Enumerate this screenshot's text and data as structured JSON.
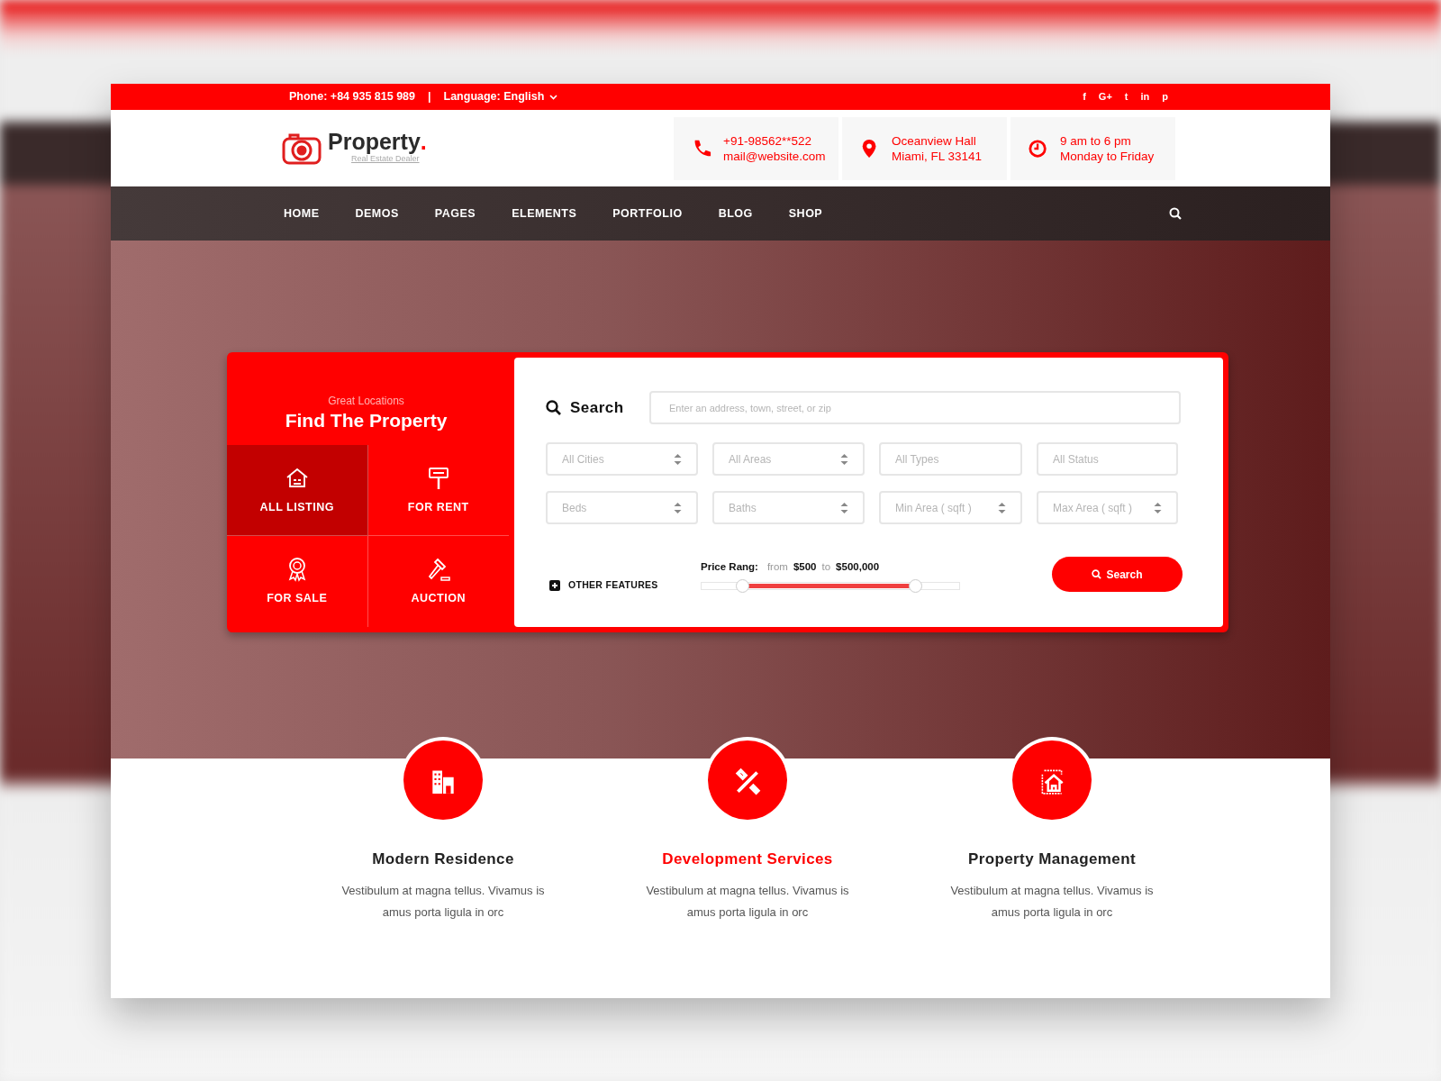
{
  "topbar": {
    "phone": "Phone:  +84 935 815 989",
    "separator": "|",
    "language": "Language:  English",
    "socials": [
      "f",
      "G+",
      "t",
      "in",
      "p"
    ]
  },
  "header": {
    "logo": {
      "name": "Property",
      "dot": ".",
      "tagline": "Real Estate Dealer"
    },
    "contacts": [
      {
        "kind": "phone",
        "lines": [
          "+91-98562**522",
          "mail@website.com"
        ]
      },
      {
        "kind": "pin",
        "lines": [
          "Oceanview Hall",
          "Miami, FL 33141"
        ]
      },
      {
        "kind": "clock",
        "lines": [
          "9 am to 6 pm",
          "Monday to Friday"
        ]
      }
    ]
  },
  "nav": {
    "items": [
      "HOME",
      "DEMOS",
      "PAGES",
      "ELEMENTS",
      "PORTFOLIO",
      "BLOG",
      "SHOP"
    ]
  },
  "finder": {
    "subtitle": "Great Locations",
    "title": "Find The Property",
    "tabs": [
      {
        "label": "ALL LISTING",
        "kind": "house",
        "selected": true
      },
      {
        "label": "FOR RENT",
        "kind": "rent",
        "selected": false
      },
      {
        "label": "FOR SALE",
        "kind": "award",
        "selected": false
      },
      {
        "label": "AUCTION",
        "kind": "gavel",
        "selected": false
      }
    ],
    "search_label": "Search",
    "search_placeholder": "Enter an address, town, street, or zip",
    "filters": [
      {
        "label": "All Cities",
        "kind": "select"
      },
      {
        "label": "All Areas",
        "kind": "select"
      },
      {
        "label": "All Types",
        "kind": "text"
      },
      {
        "label": "All Status",
        "kind": "text"
      },
      {
        "label": "Beds",
        "kind": "select"
      },
      {
        "label": "Baths",
        "kind": "select"
      },
      {
        "label": "Min Area ( sqft )",
        "kind": "select"
      },
      {
        "label": "Max Area ( sqft )",
        "kind": "select"
      }
    ],
    "other_features": "OTHER FEATURES",
    "price": {
      "label": "Price Rang:",
      "from": "from",
      "min": "$500",
      "to": "to",
      "max": "$500,000",
      "thumbs": [
        {
          "level": 0.16
        },
        {
          "level": 0.83
        }
      ]
    },
    "button": "Search"
  },
  "features": [
    {
      "title": "Modern Residence",
      "kind": "building",
      "selected": false,
      "text": "Vestibulum at magna tellus. Vivamus is amus porta ligula in orc"
    },
    {
      "title": "Development Services",
      "kind": "tools",
      "selected": true,
      "text": "Vestibulum at magna tellus. Vivamus is amus porta ligula in orc"
    },
    {
      "title": "Property Management",
      "kind": "home",
      "selected": false,
      "text": "Vestibulum at magna tellus. Vivamus is amus porta ligula in orc"
    }
  ]
}
